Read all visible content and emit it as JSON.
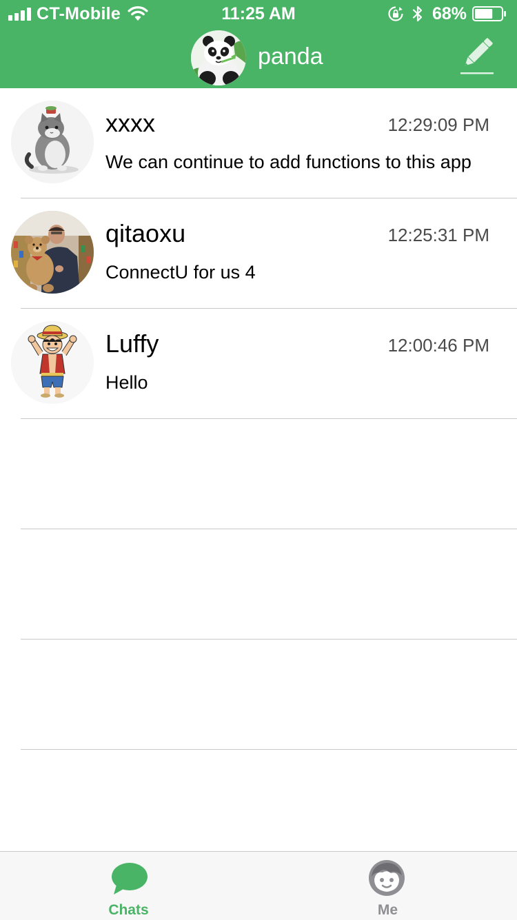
{
  "status_bar": {
    "carrier": "CT-Mobile",
    "time": "11:25 AM",
    "battery_percent": "68%",
    "battery_level": 0.68,
    "icons": [
      "signal-icon",
      "wifi-icon",
      "orientation-lock-icon",
      "bluetooth-icon",
      "battery-icon"
    ]
  },
  "nav": {
    "title": "panda",
    "avatar": "panda-avatar",
    "compose_icon": "pencil-icon"
  },
  "chats": [
    {
      "name": "xxxx",
      "time": "12:29:09 PM",
      "message": "We can continue to add functions to this app",
      "avatar": "cat-avatar"
    },
    {
      "name": "qitaoxu",
      "time": "12:25:31 PM",
      "message": "ConnectU for us 4",
      "avatar": "man-with-teddy-bear-avatar"
    },
    {
      "name": "Luffy",
      "time": "12:00:46 PM",
      "message": "Hello",
      "avatar": "luffy-cartoon-avatar"
    }
  ],
  "tabs": [
    {
      "label": "Chats",
      "icon": "chat-bubble-icon",
      "active": true
    },
    {
      "label": "Me",
      "icon": "face-icon",
      "active": false
    }
  ],
  "colors": {
    "brand_green": "#49b466",
    "tab_inactive": "#8e8e93",
    "divider": "#c8c8cc"
  }
}
